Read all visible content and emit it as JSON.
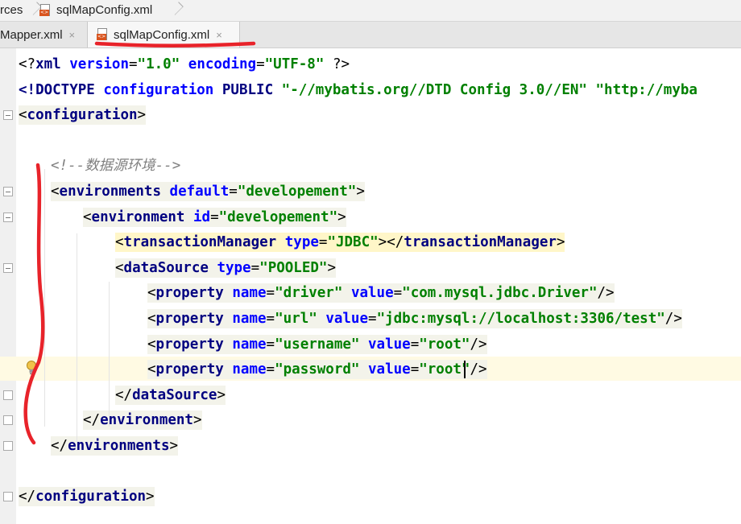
{
  "breadcrumb": {
    "items": [
      "rces",
      "sqlMapConfig.xml"
    ]
  },
  "tabs": [
    {
      "label": "Mapper.xml",
      "close": "×",
      "active": false
    },
    {
      "label": "sqlMapConfig.xml",
      "close": "×",
      "active": true
    }
  ],
  "editor": {
    "caret_line": 12,
    "lines": [
      {
        "tokens": [
          [
            "br",
            "<?"
          ],
          [
            "tag",
            "xml"
          ],
          [
            "p",
            " "
          ],
          [
            "attr",
            "version"
          ],
          [
            "p",
            "="
          ],
          [
            "val",
            "\"1.0\""
          ],
          [
            "p",
            " "
          ],
          [
            "attr",
            "encoding"
          ],
          [
            "p",
            "="
          ],
          [
            "val",
            "\"UTF-8\""
          ],
          [
            "p",
            " "
          ],
          [
            "br",
            "?>"
          ]
        ]
      },
      {
        "tokens": [
          [
            "tag",
            "<!DOCTYPE"
          ],
          [
            "p",
            " "
          ],
          [
            "attr",
            "configuration"
          ],
          [
            "p",
            " "
          ],
          [
            "tag",
            "PUBLIC"
          ],
          [
            "p",
            " "
          ],
          [
            "val",
            "\"-//mybatis.org//DTD Config 3.0//EN\""
          ],
          [
            "p",
            " "
          ],
          [
            "val",
            "\"http://myba"
          ]
        ]
      },
      {
        "tokens": [
          [
            "br",
            "<"
          ],
          [
            "tag",
            "configuration"
          ],
          [
            "br",
            ">"
          ]
        ]
      },
      {
        "tokens": []
      },
      {
        "tokens": [
          [
            "comment",
            "<!--数据源环境-->"
          ]
        ]
      },
      {
        "tokens": [
          [
            "br",
            "<"
          ],
          [
            "tag",
            "environments"
          ],
          [
            "p",
            " "
          ],
          [
            "attr",
            "default"
          ],
          [
            "p",
            "="
          ],
          [
            "val",
            "\"developement\""
          ],
          [
            "br",
            ">"
          ]
        ]
      },
      {
        "tokens": [
          [
            "br",
            "<"
          ],
          [
            "tag",
            "environment"
          ],
          [
            "p",
            " "
          ],
          [
            "attr",
            "id"
          ],
          [
            "p",
            "="
          ],
          [
            "val",
            "\"developement\""
          ],
          [
            "br",
            ">"
          ]
        ]
      },
      {
        "tokens": [
          [
            "br",
            "<"
          ],
          [
            "tag",
            "transactionManager"
          ],
          [
            "p",
            " "
          ],
          [
            "attr",
            "type"
          ],
          [
            "p",
            "="
          ],
          [
            "val",
            "\"JDBC\""
          ],
          [
            "br",
            "></"
          ],
          [
            "tag",
            "transactionManager"
          ],
          [
            "br",
            ">"
          ]
        ]
      },
      {
        "tokens": [
          [
            "br",
            "<"
          ],
          [
            "tag",
            "dataSource"
          ],
          [
            "p",
            " "
          ],
          [
            "attr",
            "type"
          ],
          [
            "p",
            "="
          ],
          [
            "val",
            "\"POOLED\""
          ],
          [
            "br",
            ">"
          ]
        ]
      },
      {
        "tokens": [
          [
            "br",
            "<"
          ],
          [
            "tag",
            "property"
          ],
          [
            "p",
            " "
          ],
          [
            "attr",
            "name"
          ],
          [
            "p",
            "="
          ],
          [
            "val",
            "\"driver\""
          ],
          [
            "p",
            " "
          ],
          [
            "attr",
            "value"
          ],
          [
            "p",
            "="
          ],
          [
            "val",
            "\"com.mysql.jdbc.Driver\""
          ],
          [
            "br",
            "/>"
          ]
        ]
      },
      {
        "tokens": [
          [
            "br",
            "<"
          ],
          [
            "tag",
            "property"
          ],
          [
            "p",
            " "
          ],
          [
            "attr",
            "name"
          ],
          [
            "p",
            "="
          ],
          [
            "val",
            "\"url\""
          ],
          [
            "p",
            " "
          ],
          [
            "attr",
            "value"
          ],
          [
            "p",
            "="
          ],
          [
            "val",
            "\"jdbc:mysql://localhost:3306/test\""
          ],
          [
            "br",
            "/>"
          ]
        ]
      },
      {
        "tokens": [
          [
            "br",
            "<"
          ],
          [
            "tag",
            "property"
          ],
          [
            "p",
            " "
          ],
          [
            "attr",
            "name"
          ],
          [
            "p",
            "="
          ],
          [
            "val",
            "\"username\""
          ],
          [
            "p",
            " "
          ],
          [
            "attr",
            "value"
          ],
          [
            "p",
            "="
          ],
          [
            "val",
            "\"root\""
          ],
          [
            "br",
            "/>"
          ]
        ]
      },
      {
        "tokens": [
          [
            "br",
            "<"
          ],
          [
            "tag",
            "property"
          ],
          [
            "p",
            " "
          ],
          [
            "attr",
            "name"
          ],
          [
            "p",
            "="
          ],
          [
            "val",
            "\"password\""
          ],
          [
            "p",
            " "
          ],
          [
            "attr",
            "value"
          ],
          [
            "p",
            "="
          ],
          [
            "val",
            "\"root\""
          ],
          [
            "br",
            "/>"
          ]
        ]
      },
      {
        "tokens": [
          [
            "br",
            "</"
          ],
          [
            "tag",
            "dataSource"
          ],
          [
            "br",
            ">"
          ]
        ]
      },
      {
        "tokens": [
          [
            "br",
            "</"
          ],
          [
            "tag",
            "environment"
          ],
          [
            "br",
            ">"
          ]
        ]
      },
      {
        "tokens": [
          [
            "br",
            "</"
          ],
          [
            "tag",
            "environments"
          ],
          [
            "br",
            ">"
          ]
        ]
      },
      {
        "tokens": []
      },
      {
        "tokens": [
          [
            "br",
            "</"
          ],
          [
            "tag",
            "configuration"
          ],
          [
            "br",
            ">"
          ]
        ]
      }
    ]
  },
  "colors": {
    "annotation": "#e8232a",
    "tag": "#000080",
    "attribute": "#0000ff",
    "value": "#008000",
    "comment": "#808080"
  },
  "icons": [
    "xml-file-icon",
    "fold-marker-icon",
    "lightbulb-icon"
  ]
}
